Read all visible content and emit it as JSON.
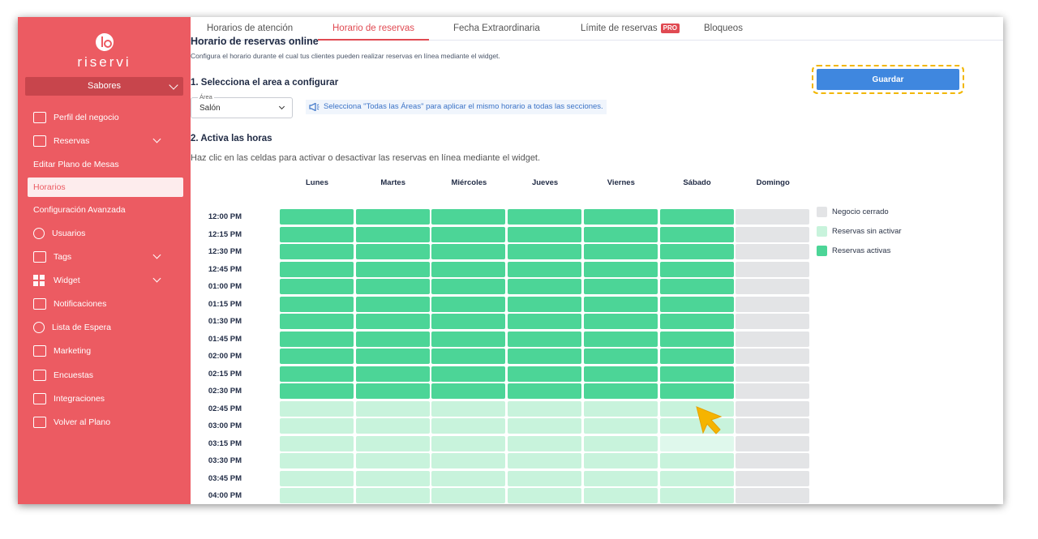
{
  "brand": {
    "name": "riservi"
  },
  "business_select": {
    "value": "Sabores"
  },
  "sidebar": {
    "items": [
      {
        "label": "Perfil del negocio",
        "icon": "store-icon",
        "has_chevron": false,
        "active": false
      },
      {
        "label": "Reservas",
        "icon": "ticket-icon",
        "has_chevron": true,
        "active": false
      },
      {
        "label": "Editar Plano de Mesas",
        "icon": "",
        "has_chevron": false,
        "active": false,
        "sub": true
      },
      {
        "label": "Horarios",
        "icon": "",
        "has_chevron": false,
        "active": true,
        "sub": true
      },
      {
        "label": "Configuración Avanzada",
        "icon": "",
        "has_chevron": false,
        "active": false,
        "sub": true
      },
      {
        "label": "Usuarios",
        "icon": "user-icon",
        "has_chevron": false,
        "active": false
      },
      {
        "label": "Tags",
        "icon": "tag-icon",
        "has_chevron": true,
        "active": false
      },
      {
        "label": "Widget",
        "icon": "grid-icon",
        "has_chevron": true,
        "active": false
      },
      {
        "label": "Notificaciones",
        "icon": "envelope-icon",
        "has_chevron": false,
        "active": false
      },
      {
        "label": "Lista de Espera",
        "icon": "clock-icon",
        "has_chevron": false,
        "active": false
      },
      {
        "label": "Marketing",
        "icon": "megaphone-icon",
        "has_chevron": false,
        "active": false
      },
      {
        "label": "Encuestas",
        "icon": "survey-icon",
        "has_chevron": false,
        "active": false
      },
      {
        "label": "Integraciones",
        "icon": "integrations-icon",
        "has_chevron": false,
        "active": false
      },
      {
        "label": "Volver al Plano",
        "icon": "table-icon",
        "has_chevron": false,
        "active": false
      }
    ]
  },
  "tabs": [
    {
      "label": "Horarios de atención",
      "active": false
    },
    {
      "label": "Horario de reservas",
      "active": true
    },
    {
      "label": "Fecha Extraordinaria",
      "active": false
    },
    {
      "label": "Límite de reservas",
      "active": false,
      "badge": "PRO"
    },
    {
      "label": "Bloqueos",
      "active": false
    }
  ],
  "main": {
    "title": "Horario de reservas online",
    "description": "Configura el horario durante el cual tus clientes pueden realizar reservas en línea mediante el widget.",
    "step1_title": "1. Selecciona el area a configurar",
    "area_select": {
      "label": "Área",
      "value": "Salón"
    },
    "hint": "Selecciona \"Todas las Áreas\" para aplicar el mismo horario a todas las secciones.",
    "step2_title": "2. Activa las horas",
    "instructions": "Haz clic en las celdas para activar o desactivar las reservas en línea mediante el widget.",
    "save_label": "Guardar"
  },
  "schedule": {
    "days": [
      "Lunes",
      "Martes",
      "Miércoles",
      "Jueves",
      "Viernes",
      "Sábado",
      "Domingo"
    ],
    "times": [
      "12:00 PM",
      "12:15 PM",
      "12:30 PM",
      "12:45 PM",
      "01:00 PM",
      "01:15 PM",
      "01:30 PM",
      "01:45 PM",
      "02:00 PM",
      "02:15 PM",
      "02:30 PM",
      "02:45 PM",
      "03:00 PM",
      "03:15 PM",
      "03:30 PM",
      "03:45 PM",
      "04:00 PM"
    ],
    "active_until_index": 10,
    "closed_days": [
      "Domingo"
    ],
    "hover_cell": {
      "day": "Sábado",
      "time": "03:15 PM"
    }
  },
  "legend": [
    {
      "label": "Negocio cerrado",
      "color": "#e3e4e6"
    },
    {
      "label": "Reservas sin activar",
      "color": "#c8f3dc"
    },
    {
      "label": "Reservas activas",
      "color": "#4cd597"
    }
  ],
  "colors": {
    "sidebar": "#ec5b62",
    "accent": "#e04a52",
    "primary_button": "#3f87df",
    "highlight": "#f1b600"
  }
}
